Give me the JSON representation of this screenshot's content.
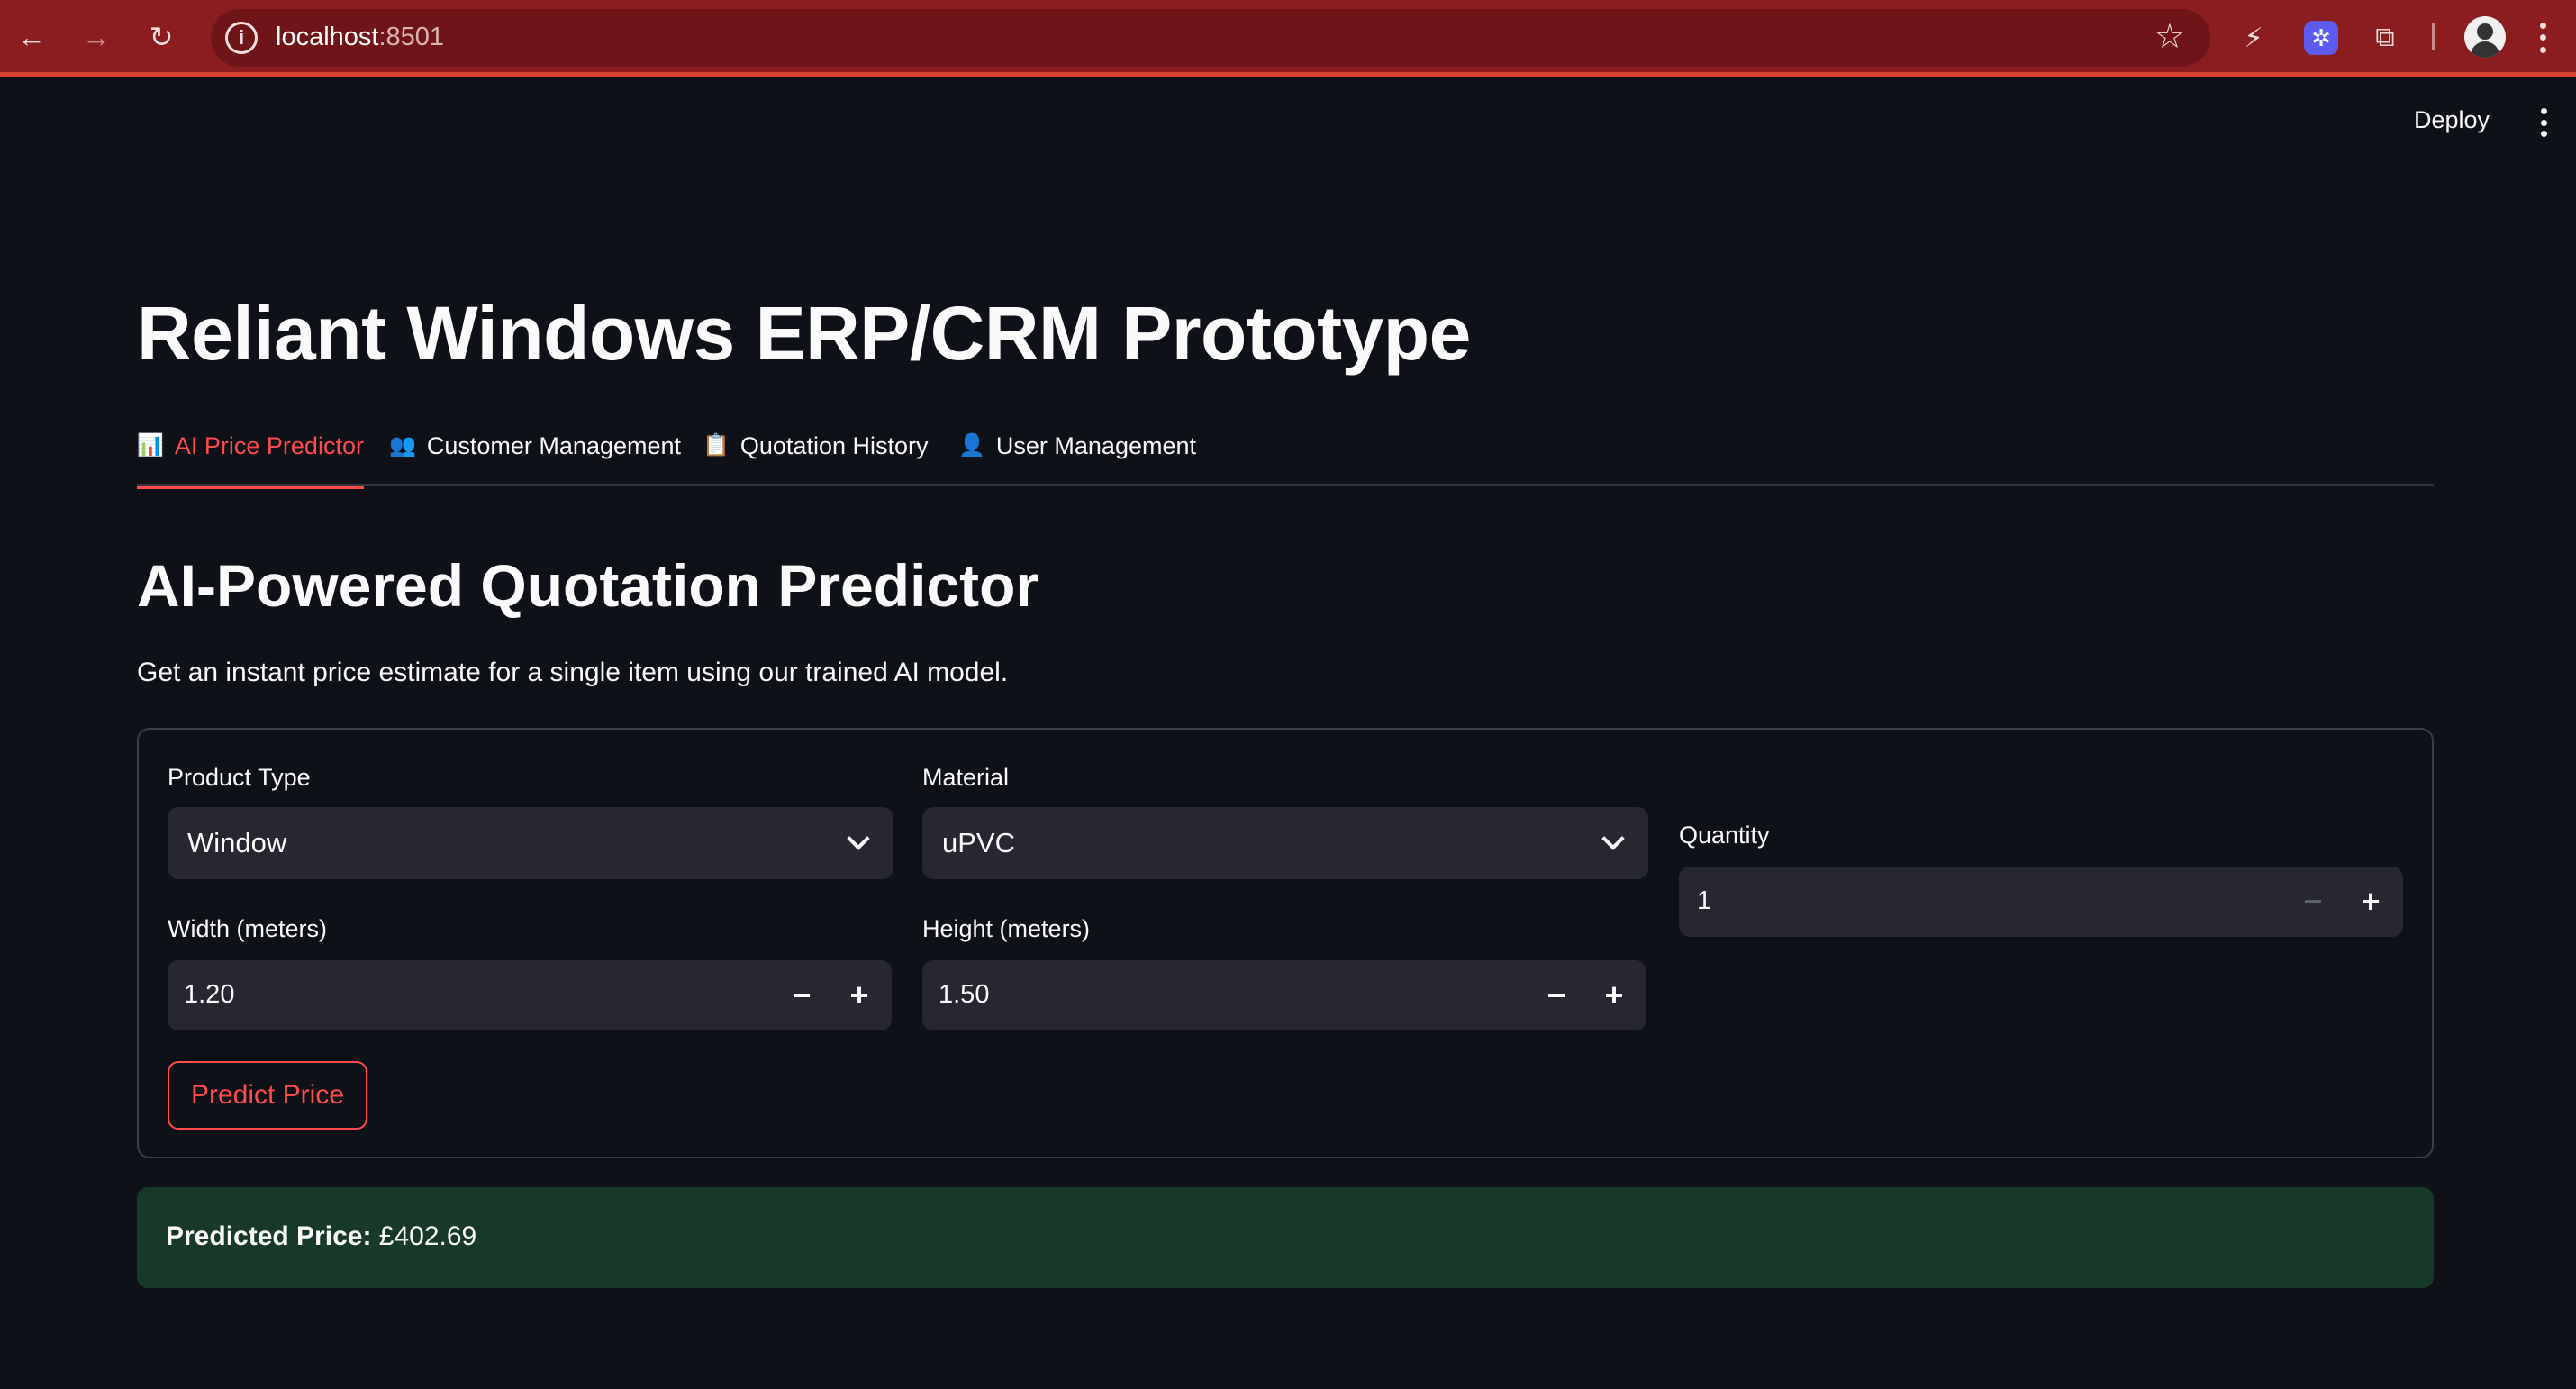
{
  "browser": {
    "url_host": "localhost",
    "url_port": ":8501"
  },
  "app_header": {
    "deploy_label": "Deploy"
  },
  "page": {
    "title": "Reliant Windows ERP/CRM Prototype"
  },
  "tabs": [
    {
      "icon": "📊",
      "label": "AI Price Predictor",
      "active": true
    },
    {
      "icon": "👥",
      "label": "Customer Management",
      "active": false
    },
    {
      "icon": "📋",
      "label": "Quotation History",
      "active": false
    },
    {
      "icon": "👤",
      "label": "User Management",
      "active": false
    }
  ],
  "predictor": {
    "heading": "AI-Powered Quotation Predictor",
    "description": "Get an instant price estimate for a single item using our trained AI model.",
    "product_type": {
      "label": "Product Type",
      "value": "Window"
    },
    "material": {
      "label": "Material",
      "value": "uPVC"
    },
    "quantity": {
      "label": "Quantity",
      "value": "1"
    },
    "width": {
      "label": "Width (meters)",
      "value": "1.20"
    },
    "height": {
      "label": "Height (meters)",
      "value": "1.50"
    },
    "predict_button": "Predict Price",
    "result_label": "Predicted Price:",
    "result_value": "£402.69"
  },
  "colors": {
    "accent": "#ff4b4b",
    "background": "#0e1117",
    "input_bg": "#262730",
    "success_bg": "#173928",
    "browser_frame": "#8c1d1f"
  }
}
